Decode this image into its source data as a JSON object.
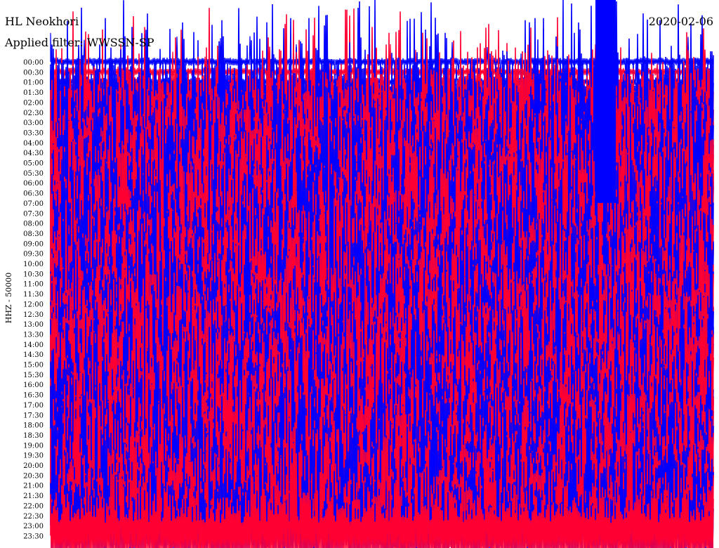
{
  "chart_data": {
    "type": "line",
    "title": "HL Neokhori",
    "subtitle": "Applied filter: WWSSN-SP",
    "date": "2020-02-06",
    "ylabel": "HHZ - 50000",
    "xlabel": "",
    "grid": false,
    "legend": false,
    "row_labels": [
      "00:00",
      "00:30",
      "01:00",
      "01:30",
      "02:00",
      "02:30",
      "03:00",
      "03:30",
      "04:00",
      "04:30",
      "05:00",
      "05:30",
      "06:00",
      "06:30",
      "07:00",
      "07:30",
      "08:00",
      "08:30",
      "09:00",
      "09:30",
      "10:00",
      "10:30",
      "11:00",
      "11:30",
      "12:00",
      "12:30",
      "13:00",
      "13:30",
      "14:00",
      "14:30",
      "15:00",
      "15:30",
      "16:00",
      "16:30",
      "17:00",
      "17:30",
      "18:00",
      "18:30",
      "19:00",
      "19:30",
      "20:00",
      "20:30",
      "21:00",
      "21:30",
      "22:00",
      "22:30",
      "23:00",
      "23:30"
    ],
    "row_minutes": 30,
    "series": [
      {
        "color": "#0000ff",
        "rows": "00:00, 01:00, 02:00 ... 23:00"
      },
      {
        "color": "#ff0033",
        "rows": "00:30, 01:30, 02:30 ... 23:30"
      }
    ],
    "quiet_rows": [
      "00:00",
      "00:30",
      "01:00",
      "01:30"
    ],
    "saturation_event": {
      "start_row": "00:00",
      "end_row": "07:00",
      "color": "#0000ff"
    }
  }
}
